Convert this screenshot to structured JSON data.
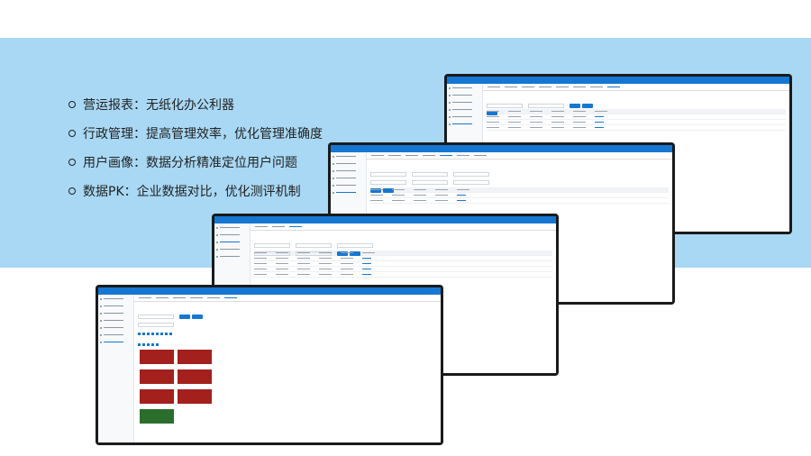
{
  "features": [
    "营运报表：无纸化办公利器",
    "行政管理：提高管理效率，优化管理准确度",
    "用户画像：数据分析精准定位用户问题",
    "数据PK：企业数据对比，优化测评机制"
  ],
  "colors": {
    "band": "#a8d8f4",
    "accent": "#1677d2",
    "frame": "#1a1a1a"
  }
}
